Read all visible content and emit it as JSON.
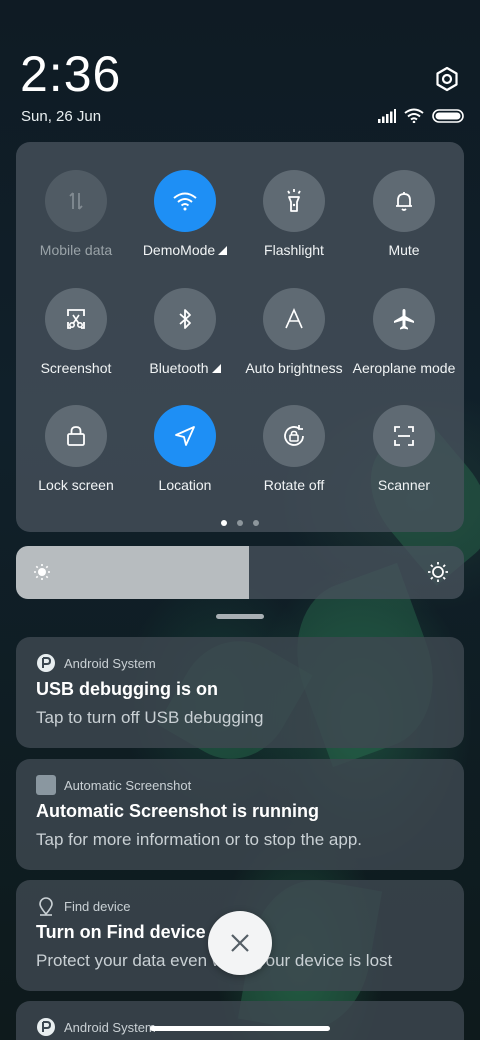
{
  "header": {
    "time": "2:36",
    "date": "Sun, 26 Jun"
  },
  "quick_settings": {
    "tiles": [
      {
        "label": "Mobile data",
        "icon": "mobile-data-icon",
        "state": "disabled"
      },
      {
        "label": "DemoMode",
        "icon": "wifi-icon",
        "state": "active",
        "expandable": true
      },
      {
        "label": "Flashlight",
        "icon": "flashlight-icon",
        "state": "off"
      },
      {
        "label": "Mute",
        "icon": "bell-icon",
        "state": "off"
      },
      {
        "label": "Screenshot",
        "icon": "screenshot-icon",
        "state": "off"
      },
      {
        "label": "Bluetooth",
        "icon": "bluetooth-icon",
        "state": "off",
        "expandable": true
      },
      {
        "label": "Auto brightness",
        "icon": "auto-brightness-icon",
        "state": "off"
      },
      {
        "label": "Aeroplane mode",
        "icon": "airplane-icon",
        "state": "off"
      },
      {
        "label": "Lock screen",
        "icon": "lock-icon",
        "state": "off"
      },
      {
        "label": "Location",
        "icon": "location-icon",
        "state": "active"
      },
      {
        "label": "Rotate off",
        "icon": "rotate-lock-icon",
        "state": "off"
      },
      {
        "label": "Scanner",
        "icon": "scanner-icon",
        "state": "off"
      }
    ],
    "page_count": 3,
    "current_page": 1
  },
  "brightness": {
    "level": 0.52
  },
  "notifications": [
    {
      "app": "Android System",
      "title": "USB debugging is on",
      "body": "Tap to turn off USB debugging"
    },
    {
      "app": "Automatic Screenshot",
      "title": "Automatic Screenshot is running",
      "body": "Tap for more information or to stop the app."
    },
    {
      "app": "Find device",
      "title": "Turn on Find device",
      "body": "Protect your data even when your device is lost"
    },
    {
      "app": "Android System"
    }
  ],
  "colors": {
    "active": "#1e8ff5",
    "panel": "#48525c"
  }
}
